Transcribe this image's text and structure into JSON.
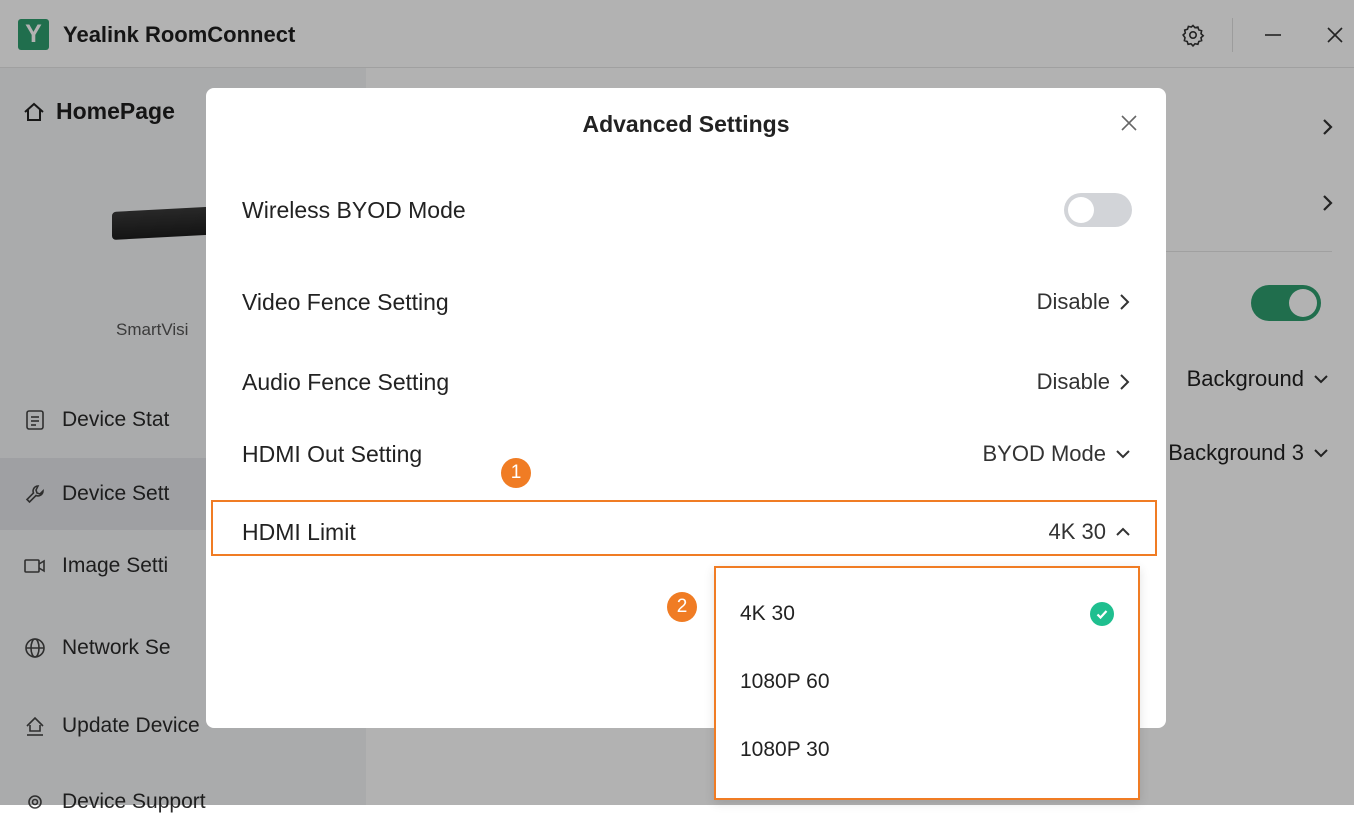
{
  "app": {
    "title": "Yealink RoomConnect",
    "logo_letter": "Y"
  },
  "sidebar": {
    "home": "HomePage",
    "device_name": "SmartVisi",
    "items": [
      {
        "label": "Device Stat",
        "icon": "document-icon"
      },
      {
        "label": "Device Sett",
        "icon": "wrench-icon"
      },
      {
        "label": "Image Setti",
        "icon": "camera-icon"
      },
      {
        "label": "Network Se",
        "icon": "globe-icon"
      },
      {
        "label": "Update Device",
        "icon": "upload-icon"
      },
      {
        "label": "Device Support",
        "icon": "support-icon"
      }
    ]
  },
  "main": {
    "background_select_1": "Background",
    "background_select_2": "Background 3"
  },
  "modal": {
    "title": "Advanced Settings",
    "rows": {
      "wireless_byod": {
        "label": "Wireless BYOD Mode"
      },
      "video_fence": {
        "label": "Video Fence Setting",
        "value": "Disable"
      },
      "audio_fence": {
        "label": "Audio Fence Setting",
        "value": "Disable"
      },
      "hdmi_out": {
        "label": "HDMI Out Setting",
        "value": "BYOD Mode"
      },
      "hdmi_limit": {
        "label": "HDMI Limit",
        "value": "4K 30"
      }
    }
  },
  "dropdown": {
    "options": [
      {
        "label": "4K 30",
        "selected": true
      },
      {
        "label": "1080P 60",
        "selected": false
      },
      {
        "label": "1080P 30",
        "selected": false
      }
    ]
  },
  "annotations": {
    "badge_1": "1",
    "badge_2": "2"
  },
  "colors": {
    "accent": "#2f9e6f",
    "highlight": "#f07c24",
    "check": "#1fbf8f"
  }
}
